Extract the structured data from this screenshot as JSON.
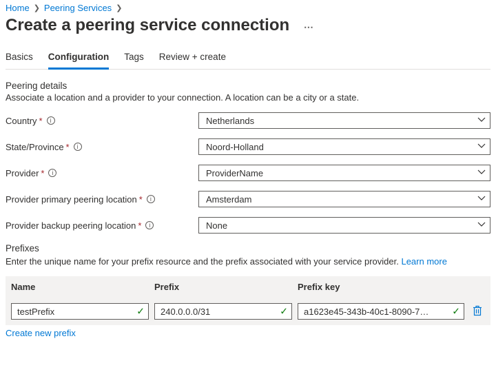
{
  "breadcrumb": {
    "home": "Home",
    "peering_services": "Peering Services"
  },
  "page": {
    "title": "Create a peering service connection"
  },
  "tabs": {
    "basics": "Basics",
    "configuration": "Configuration",
    "tags": "Tags",
    "review": "Review + create"
  },
  "peering_details": {
    "title": "Peering details",
    "desc": "Associate a location and a provider to your connection. A location can be a city or a state.",
    "fields": {
      "country": {
        "label": "Country",
        "value": "Netherlands"
      },
      "state": {
        "label": "State/Province",
        "value": "Noord-Holland"
      },
      "provider": {
        "label": "Provider",
        "value": "ProviderName"
      },
      "primary": {
        "label": "Provider primary peering location",
        "value": "Amsterdam"
      },
      "backup": {
        "label": "Provider backup peering location",
        "value": "None"
      }
    }
  },
  "prefixes": {
    "title": "Prefixes",
    "desc": "Enter the unique name for your prefix resource and the prefix associated with your service provider. ",
    "learn_more": "Learn more",
    "headers": {
      "name": "Name",
      "prefix": "Prefix",
      "key": "Prefix key"
    },
    "row": {
      "name": "testPrefix",
      "prefix": "240.0.0.0/31",
      "key": "a1623e45-343b-40c1-8090-7…"
    },
    "create_new": "Create new prefix"
  }
}
